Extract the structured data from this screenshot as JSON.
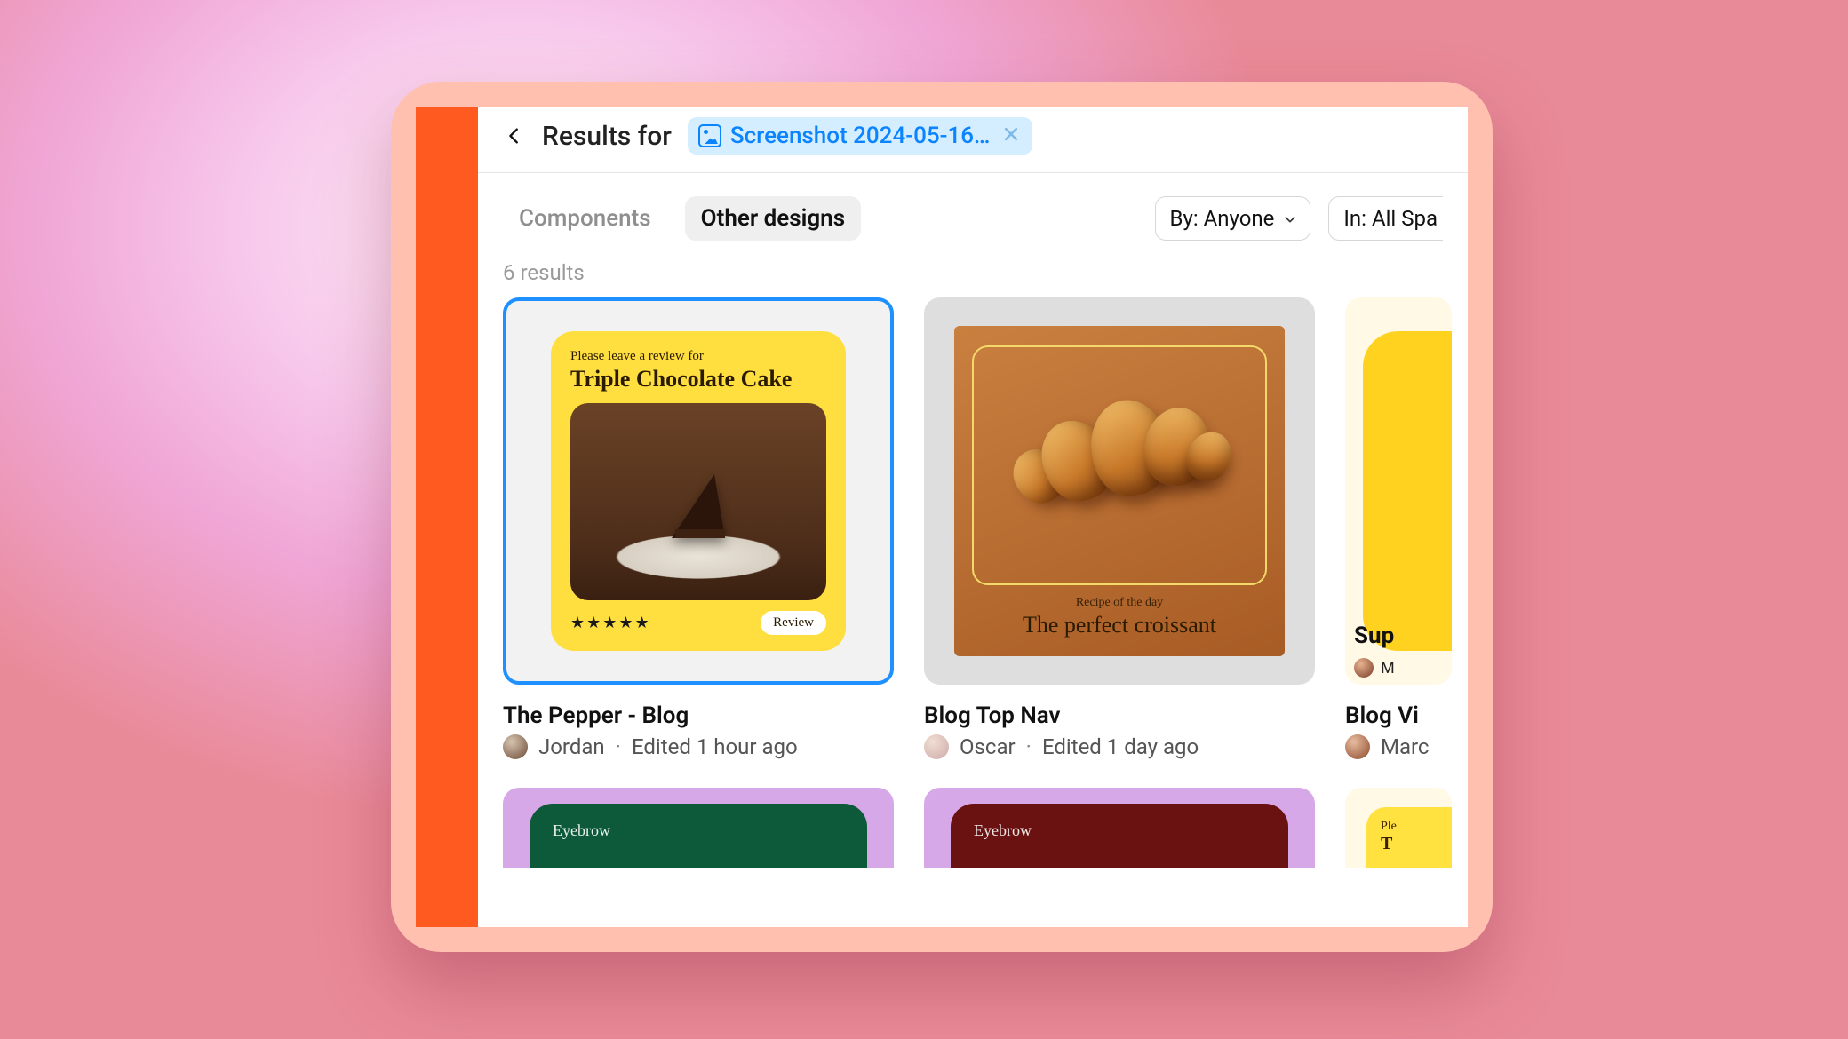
{
  "header": {
    "results_for": "Results for",
    "chip_label": "Screenshot 2024-05-16…"
  },
  "tabs": {
    "components": "Components",
    "other_designs": "Other designs"
  },
  "filters": {
    "by": "By: Anyone",
    "in": "In: All Spa"
  },
  "results_count": "6 results",
  "cards": [
    {
      "preview": {
        "subtitle": "Please leave a review for",
        "title": "Triple Chocolate Cake",
        "stars": "★★★★★",
        "button": "Review"
      },
      "title": "The Pepper - Blog",
      "author": "Jordan",
      "edited": "Edited 1 hour ago"
    },
    {
      "preview": {
        "subtitle": "Recipe of the day",
        "title": "The perfect croissant"
      },
      "title": "Blog Top Nav",
      "author": "Oscar",
      "edited": "Edited 1 day ago"
    },
    {
      "preview": {
        "title_partial": "Sup",
        "author_partial": "M"
      },
      "title": "Blog Vi",
      "author": "Marc"
    }
  ],
  "row2": {
    "eyebrow": "Eyebrow",
    "yellow_partial_1": "Ple",
    "yellow_partial_2": "T"
  }
}
